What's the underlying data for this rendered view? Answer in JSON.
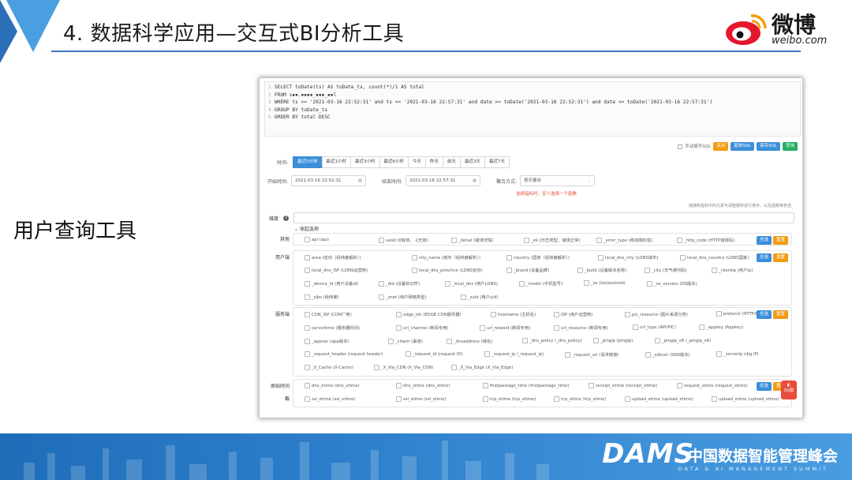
{
  "slide": {
    "title": "4. 数据科学应用—交互式BI分析工具",
    "side_label": "用户查询工具",
    "logo_text": "微博",
    "logo_url": "weibo.com"
  },
  "sql": {
    "lines": [
      {
        "num": "1",
        "text": "SELECT toDate(ts) AS toDate_ts, count(*)/1 AS total"
      },
      {
        "num": "2",
        "text": "FROM s▪▪.▪▪▪▪_▪▪▪_▪▪l"
      },
      {
        "num": "3",
        "text": "WHERE ts >= '2021-03-16 22:52:31' and ts <= '2021-03-16 22:57:31' and date >= toDate('2021-03-16 22:52:31') and date <= toDate('2021-03-16 22:57:31')"
      },
      {
        "num": "4",
        "text": "GROUP BY toDate_ts"
      },
      {
        "num": "5",
        "text": "ORDER BY total DESC"
      }
    ]
  },
  "toolbar": {
    "manual_sql": "手动填写SQL",
    "close": "关闭",
    "copy_sql": "复制SQL",
    "save_sql": "保存SQL",
    "query": "查询"
  },
  "time": {
    "label": "时间:",
    "options": [
      "最近5分钟",
      "最近1小时",
      "最近3小时",
      "最近6小时",
      "今天",
      "昨天",
      "前天",
      "最近3天",
      "最近7天"
    ],
    "active_index": 0
  },
  "date_range": {
    "start_label": "开始时间:",
    "start_value": "2021-03-16 22:52:31",
    "end_label": "结束时间:",
    "end_value": "2021-03-16 22:57:31",
    "agg_label": "聚合方式:",
    "agg_value": "按天聚合",
    "warning": "选择指标时，至少选择一个函数",
    "hint": "拖拽和指标中的元素可调整顺序进行排序，以及函数等参选"
  },
  "dimension": {
    "label": "维度",
    "collapse": "收起选项"
  },
  "groups": {
    "other": {
      "label": "其他",
      "items": [
        "api (api)",
        "valid (0有效，-1无效)",
        "_detail (错误详情)",
        "_ek (日志类型、错误正常)",
        "_error_type (移动端标签)",
        "_http_code (HTTP错误码)"
      ]
    },
    "user": {
      "label": "用户端",
      "items": [
        "area (省份（经纬度解析）)",
        "city_name (城市（经纬度解析）)",
        "country (国家（经纬度解析）)",
        "local_dns_city (LDNS城市)",
        "local_dns_country (LDNS国家)",
        "local_dns_ISP (LDNS运营商)",
        "local_dns_province (LDNS省份)",
        "_brand (设备品牌)",
        "_build (设备版本名称)",
        "_city (天气通代码)",
        "_clientip (用户ip)",
        "_device_id (用户设备id)",
        "_did (设备标识符)",
        "_local_dns (用户LDNS)",
        "_model (手机型号)",
        "_os (ios/android)",
        "_os_version (OS版本)",
        "_sibs (经纬度)",
        "_snet (用户网络类型)",
        "_suid (用户uid)"
      ]
    },
    "server": {
      "label": "服务端",
      "items": [
        "CDN_ISP (CDN厂商)",
        "edge_idc (EDGE CDN服务器)",
        "hostname (主机名)",
        "ISP (用户运营商)",
        "pic_resource (图片来源分类)",
        "protocol (HTTP/HT...",
        "servertime (服务器时间)",
        "url_channel (新闻专用)",
        "url_newsid (新闻专用)",
        "url_resource (新闻专用)",
        "url_type (API/PIC)",
        "_appkey (Appkey)",
        "_appver (app版本)",
        "_chwm (渠道)",
        "_dnsaddress (域名)",
        "_dns_policy (_dns_policy)",
        "_pingip (pingip)",
        "_pingip_v6 (_pingip_v6)",
        "_request_header (request header)",
        "_request_id (request ID)",
        "_request_ip (_request_ip)",
        "_request_url (请求链接)",
        "_sdkver (SDK版本)",
        "_serverip (dig IP)",
        "_X_Cache (X-Cache)",
        "_X_Via_CDN (X_Via_CDN)",
        "_X_Via_Edge (X_Via_Edge)"
      ]
    },
    "timing": {
      "label": "原始时间",
      "sub_label": "截",
      "items": [
        "dns_etime (dns_etime)",
        "dns_stime (dns_stime)",
        "firstpackage_time (firstpackage_time)",
        "receipt_etime (receipt_etime)",
        "request_stime (request_stime)",
        "ssl_etime (ssl_etime)",
        "ssl_stime (ssl_stime)",
        "tcp_etime (tcp_etime)",
        "tcp_stime (tcp_stime)",
        "upload_etime (upload_etime)",
        "upload_stime (upload_stime)"
      ]
    },
    "select_all": "全选",
    "reset": "重置",
    "float_badge": "QQ群"
  },
  "banner": {
    "dams": "DAMS",
    "conf": "中国数据智能管理峰会",
    "conf_sub": "DATA & AI MANAGEMENT SUMMIT"
  },
  "colors": {
    "accent_blue": "#3b8fd9",
    "orange": "#f39c12",
    "green": "#27ae60",
    "warn_red": "#e74c3c",
    "header_line": "#3c77c3"
  }
}
